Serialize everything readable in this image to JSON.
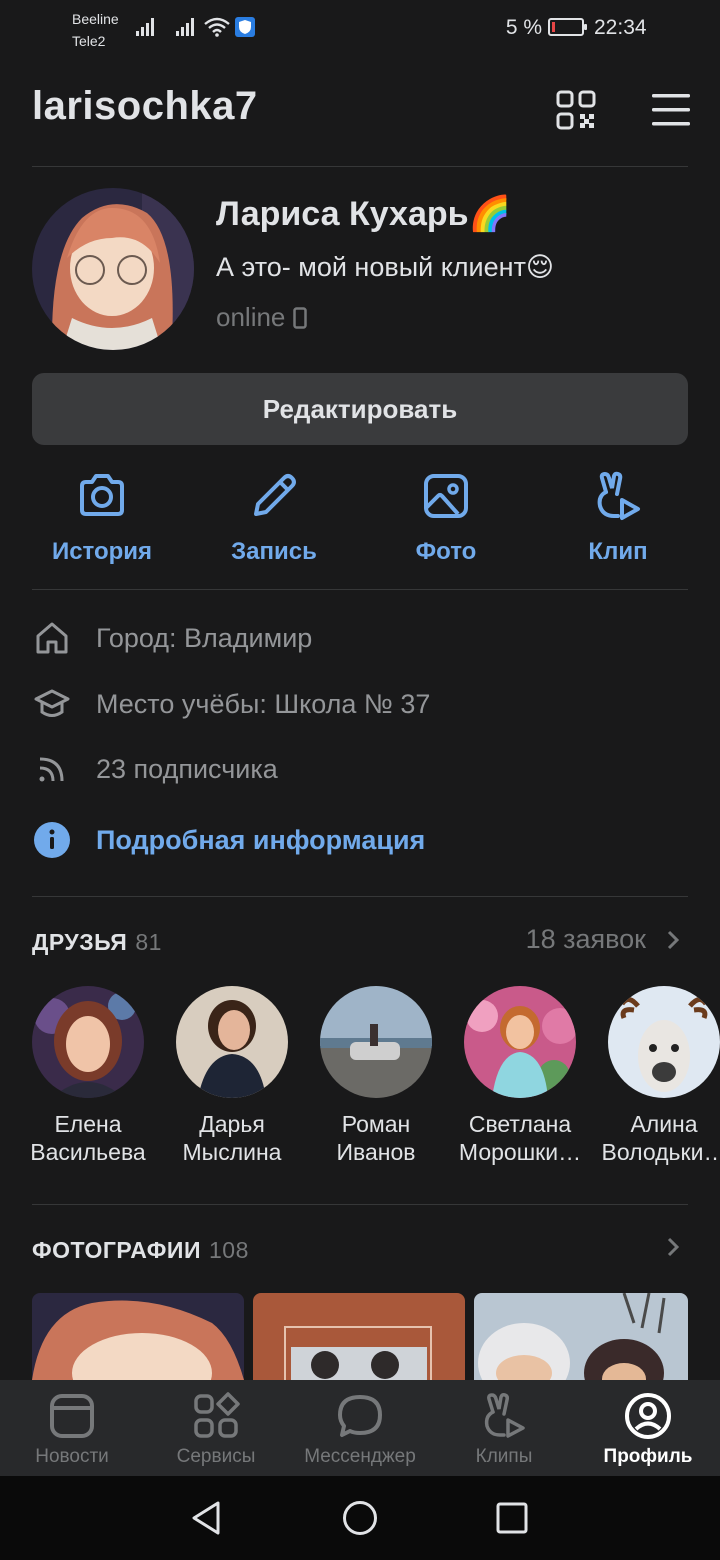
{
  "status_bar": {
    "carrier1": "Beeline",
    "carrier2": "Tele2",
    "battery": "5 %",
    "time": "22:34"
  },
  "header": {
    "username": "larisochka7",
    "icons": [
      "qr-code-icon",
      "menu-icon"
    ]
  },
  "profile": {
    "name": "Лариса Кухарь🌈",
    "status": "А это- мой новый клиент😌",
    "online": "online"
  },
  "edit_button": "Редактировать",
  "actions": [
    {
      "label": "История",
      "icon": "camera-icon"
    },
    {
      "label": "Запись",
      "icon": "pencil-icon"
    },
    {
      "label": "Фото",
      "icon": "image-icon"
    },
    {
      "label": "Клип",
      "icon": "clip-icon"
    }
  ],
  "info": {
    "city": "Город: Владимир",
    "school": "Место учёбы: Школа № 37",
    "followers": "23 подписчика",
    "more": "Подробная информация"
  },
  "friends": {
    "title": "ДРУЗЬЯ",
    "count": "81",
    "requests": "18 заявок",
    "list": [
      {
        "first": "Елена",
        "last": "Васильева"
      },
      {
        "first": "Дарья",
        "last": "Мыслина"
      },
      {
        "first": "Роман",
        "last": "Иванов"
      },
      {
        "first": "Светлана",
        "last": "Морошки…"
      },
      {
        "first": "Алина",
        "last": "Володьки…"
      }
    ]
  },
  "photos": {
    "title": "ФОТОГРАФИИ",
    "count": "108"
  },
  "tabs": [
    {
      "label": "Новости",
      "icon": "news-icon"
    },
    {
      "label": "Сервисы",
      "icon": "services-icon"
    },
    {
      "label": "Мессенджер",
      "icon": "messenger-icon"
    },
    {
      "label": "Клипы",
      "icon": "clips-icon"
    },
    {
      "label": "Профиль",
      "icon": "profile-icon",
      "active": true
    }
  ],
  "colors": {
    "background": "#19191a",
    "accent": "#71aaeb",
    "secondary_text": "#949699",
    "button": "#3a3b3d",
    "tabbar": "#28292b"
  }
}
